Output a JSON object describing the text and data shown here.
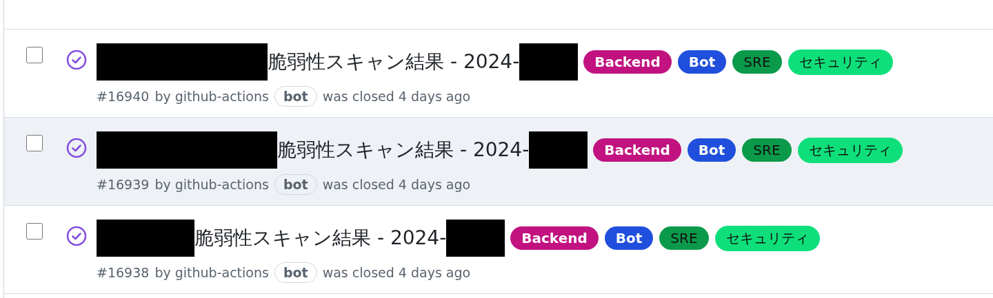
{
  "issues": [
    {
      "title": "脆弱性スキャン結果 - 2024-",
      "checked": false,
      "highlighted": false,
      "number": "#16940",
      "author": "by github-actions",
      "author_badge": "bot",
      "status": "was closed 4 days ago",
      "labels": [
        {
          "name": "Backend",
          "color": "#c1127f"
        },
        {
          "name": "Bot",
          "color": "#1f4fdc"
        },
        {
          "name": "SRE",
          "color": "#0a9a4a"
        },
        {
          "name": "セキュリティ",
          "color": "#0fdf7a"
        }
      ]
    },
    {
      "title": "脆弱性スキャン結果 - 2024-",
      "checked": false,
      "highlighted": true,
      "number": "#16939",
      "author": "by github-actions",
      "author_badge": "bot",
      "status": "was closed 4 days ago",
      "labels": [
        {
          "name": "Backend",
          "color": "#c1127f"
        },
        {
          "name": "Bot",
          "color": "#1f4fdc"
        },
        {
          "name": "SRE",
          "color": "#0a9a4a"
        },
        {
          "name": "セキュリティ",
          "color": "#0fdf7a"
        }
      ]
    },
    {
      "title": "脆弱性スキャン結果 - 2024-",
      "checked": false,
      "highlighted": false,
      "number": "#16938",
      "author": "by github-actions",
      "author_badge": "bot",
      "status": "was closed 4 days ago",
      "labels": [
        {
          "name": "Backend",
          "color": "#c1127f"
        },
        {
          "name": "Bot",
          "color": "#1f4fdc"
        },
        {
          "name": "SRE",
          "color": "#0a9a4a"
        },
        {
          "name": "セキュリティ",
          "color": "#0fdf7a"
        }
      ]
    }
  ]
}
